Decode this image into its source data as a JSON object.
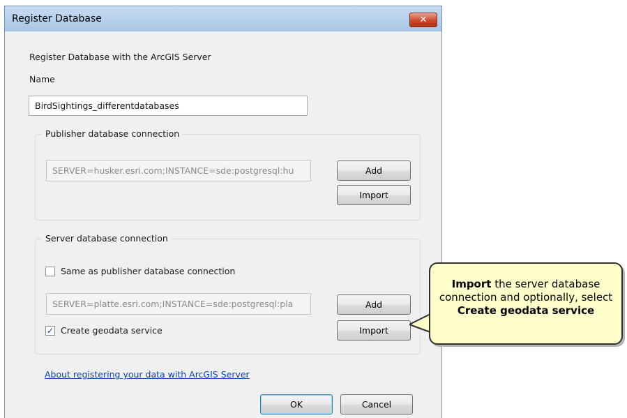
{
  "dialog": {
    "title": "Register Database",
    "close_icon": "close-x-icon",
    "heading": "Register Database with the ArcGIS Server",
    "name_label": "Name",
    "name_value": "BirdSightings_differentdatabases",
    "publisher": {
      "legend": "Publisher database connection",
      "connection_string": "SERVER=husker.esri.com;INSTANCE=sde:postgresql:hu",
      "add_label": "Add",
      "import_label": "Import"
    },
    "server": {
      "legend": "Server database connection",
      "same_as_label": "Same as publisher database connection",
      "same_as_checked": false,
      "connection_string": "SERVER=platte.esri.com;INSTANCE=sde:postgresql:pla",
      "add_label": "Add",
      "import_label": "Import",
      "create_service_label": "Create geodata service",
      "create_service_checked": true,
      "check_mark": "✓"
    },
    "help_link": "About registering your data with ArcGIS Server",
    "ok_label": "OK",
    "cancel_label": "Cancel"
  },
  "callout": {
    "part1_bold": "Import",
    "part2": " the server database connection and optionally, select ",
    "part3_bold": "Create geodata service"
  },
  "colors": {
    "callout_fill": "#ffffcc",
    "close_button": "#c9492c",
    "link": "#0645ad"
  }
}
